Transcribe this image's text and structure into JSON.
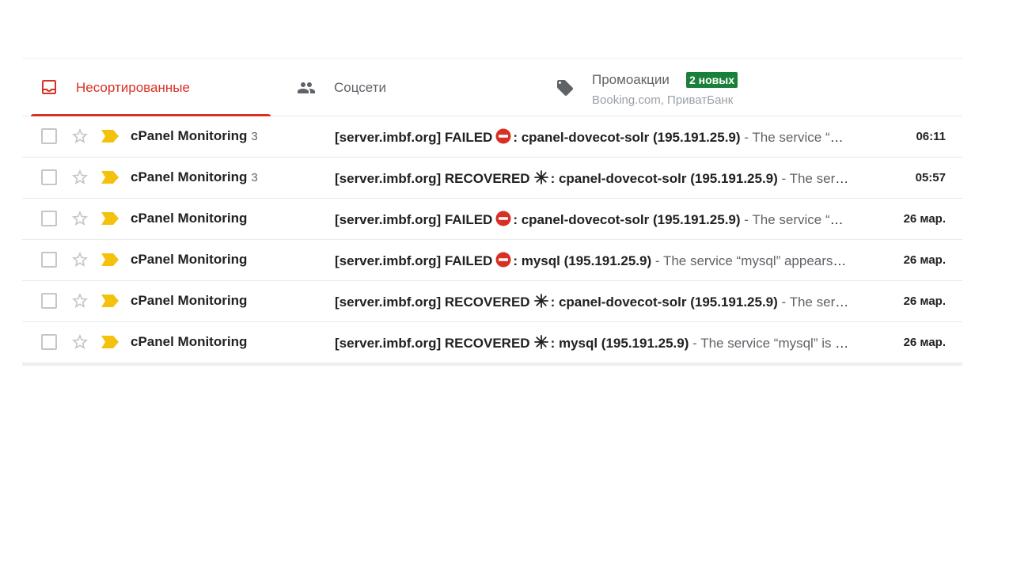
{
  "colors": {
    "accent": "#d93025",
    "badge": "#188038",
    "important_marker": "#f4c20d",
    "failed_icon": "#d93025"
  },
  "tabs": {
    "primary": {
      "label": "Несортированные",
      "icon": "inbox-icon"
    },
    "social": {
      "label": "Соцсети",
      "icon": "people-icon"
    },
    "promotions": {
      "label": "Промоакции",
      "icon": "tag-icon",
      "badge": "2 новых",
      "sub": "Booking.com, ПриватБанк"
    }
  },
  "emails": [
    {
      "sender": "cPanel Monitoring",
      "count": "3",
      "subject_pre": "[server.imbf.org] FAILED",
      "status_icon": "no-entry-icon",
      "subject_post": ": cpanel-dovecot-solr (195.191.25.9)",
      "snippet": " - The service “cpanel-dovecot-solr” appears to be down.",
      "date": "06:11"
    },
    {
      "sender": "cPanel Monitoring",
      "count": "3",
      "subject_pre": "[server.imbf.org] RECOVERED",
      "status_icon": "sparkle-icon",
      "subject_post": ": cpanel-dovecot-solr (195.191.25.9)",
      "snippet": " - The service “cpanel-dovecot-solr” is now operational.",
      "date": "05:57"
    },
    {
      "sender": "cPanel Monitoring",
      "count": "",
      "subject_pre": "[server.imbf.org] FAILED",
      "status_icon": "no-entry-icon",
      "subject_post": ": cpanel-dovecot-solr (195.191.25.9)",
      "snippet": " - The service “cpanel-dovecot-solr” appears to be down.",
      "date": "26 мар."
    },
    {
      "sender": "cPanel Monitoring",
      "count": "",
      "subject_pre": "[server.imbf.org] FAILED",
      "status_icon": "no-entry-icon",
      "subject_post": ": mysql (195.191.25.9)",
      "snippet": " - The service “mysql” appears to be down.",
      "date": "26 мар."
    },
    {
      "sender": "cPanel Monitoring",
      "count": "",
      "subject_pre": "[server.imbf.org] RECOVERED",
      "status_icon": "sparkle-icon",
      "subject_post": ": cpanel-dovecot-solr (195.191.25.9)",
      "snippet": " - The service “cpanel-dovecot-solr” is now operational.",
      "date": "26 мар."
    },
    {
      "sender": "cPanel Monitoring",
      "count": "",
      "subject_pre": "[server.imbf.org] RECOVERED",
      "status_icon": "sparkle-icon",
      "subject_post": ": mysql (195.191.25.9)",
      "snippet": " - The service “mysql” is now operational.",
      "date": "26 мар."
    }
  ]
}
